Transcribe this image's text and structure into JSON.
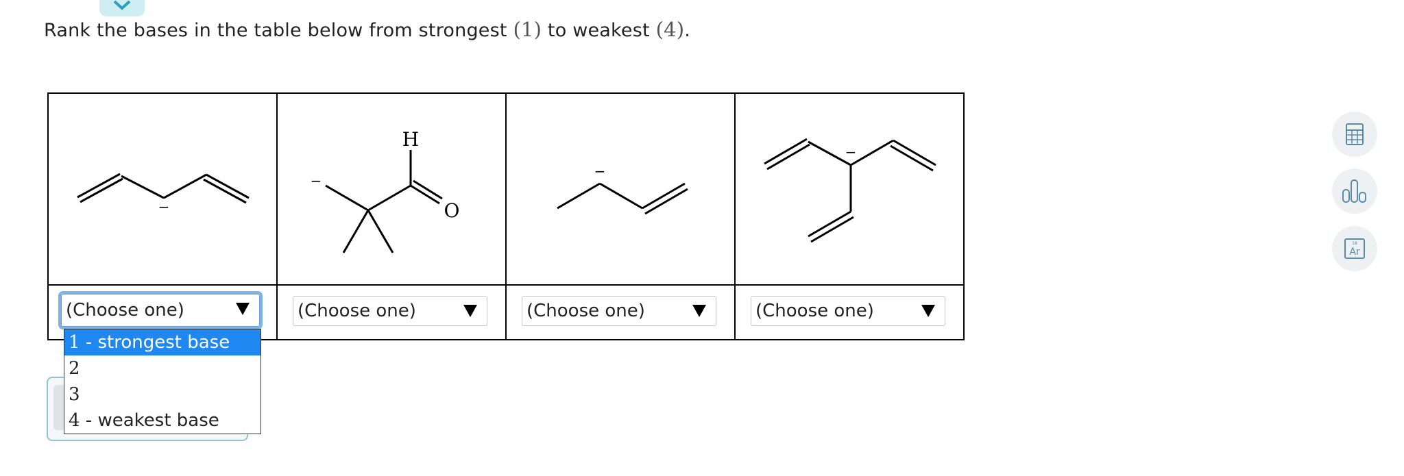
{
  "instruction": {
    "prefix": "Rank the bases in the table below from strongest ",
    "strongest_num": "(1)",
    "middle": " to weakest ",
    "weakest_num": "(4)",
    "suffix": "."
  },
  "molecules": [
    {
      "label": "−"
    },
    {
      "label_h": "H",
      "label_o": "O",
      "label_minus": "−"
    },
    {
      "label": "−"
    },
    {
      "label": "−"
    }
  ],
  "selects": [
    {
      "value": "(Choose one)"
    },
    {
      "value": "(Choose one)"
    },
    {
      "value": "(Choose one)"
    },
    {
      "value": "(Choose one)"
    }
  ],
  "dropdown": {
    "options": [
      {
        "num": "1",
        "text": " - strongest base"
      },
      {
        "num": "2",
        "text": ""
      },
      {
        "num": "3",
        "text": ""
      },
      {
        "num": "4",
        "text": " - weakest base"
      }
    ]
  },
  "tools": {
    "icons": [
      "calculator-icon",
      "bar-chart-icon",
      "periodic-table-icon"
    ],
    "periodic_label": "Ar",
    "periodic_number": "18"
  },
  "colors": {
    "highlight": "#1e88f0",
    "tool_icon": "#5b8aa6",
    "tab": "#cfeef4"
  }
}
